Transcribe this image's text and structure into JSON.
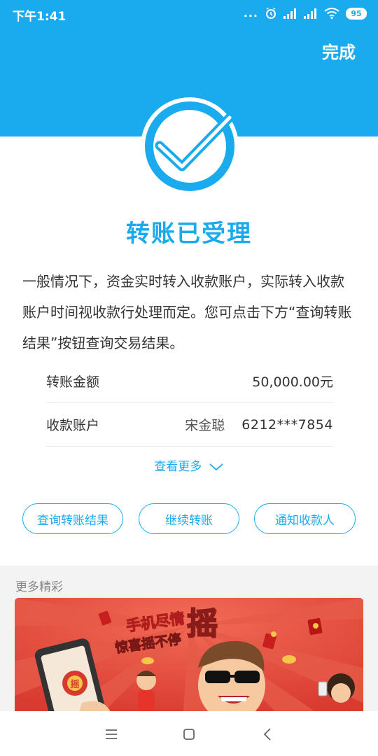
{
  "status_bar": {
    "time": "下午1:41",
    "dots": "...",
    "battery": "95"
  },
  "header": {
    "done_label": "完成"
  },
  "result": {
    "title": "转账已受理",
    "description": "一般情况下，资金实时转入收款账户，实际转入收款账户时间视收款行处理而定。您可点击下方“查询转账结果”按钮查询交易结果。"
  },
  "details": {
    "amount_label": "转账金额",
    "amount_value": "50,000.00元",
    "payee_label": "收款账户",
    "payee_name": "宋金聪",
    "payee_account": "6212***7854"
  },
  "view_more": "查看更多",
  "buttons": {
    "query_result": "查询转账结果",
    "continue_transfer": "继续转账",
    "notify_payee": "通知收款人"
  },
  "more_section": {
    "title": "更多精彩",
    "banner_text_line1": "手机尽情",
    "banner_text_line2": "惊喜摇不停",
    "banner_big_char": "摇",
    "phone_char": "摇"
  },
  "colors": {
    "accent": "#1AABEF",
    "banner_bg": "#EA4B3C"
  },
  "icons": {
    "check": "check-circle-icon",
    "menu": "menu-icon",
    "home": "home-icon",
    "back": "back-icon"
  }
}
